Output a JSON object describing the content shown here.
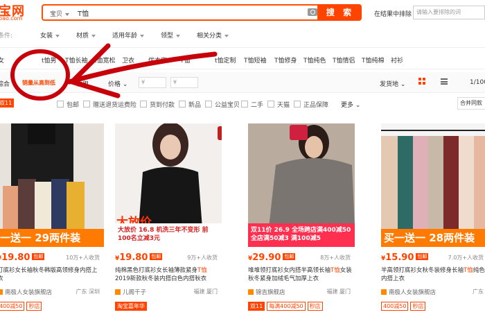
{
  "header": {
    "logo": "宝网",
    "logo_sub": "bao.com",
    "search_scope": "宝贝",
    "search_value": "T恤",
    "search_button": "搜 索",
    "within_label": "在结果中排除",
    "within_placeholder": "请输入要排除的词"
  },
  "filter1": {
    "label": "条件:",
    "items": [
      "女装",
      "材质",
      "适用年龄",
      "领型",
      "相关分类"
    ]
  },
  "filter2": {
    "items": [
      "女",
      "t恤男",
      "T恤长袖",
      "t恤宽松",
      "卫衣",
      "优衣库",
      "T恤",
      "t恤定制",
      "T恤短袖",
      "T恤修身",
      "T恤纯色",
      "T恤情侣",
      "T恤纯棉",
      "衬衫"
    ]
  },
  "sortbar": {
    "left": "综合",
    "sales": "销量从高到低",
    "credit": "信用",
    "price": "价格",
    "price_from": "¥",
    "price_to": "¥",
    "ship_from": "发货地",
    "page": "1/100"
  },
  "filter3": {
    "badge": "双11",
    "checks": [
      "包邮",
      "赠送退货运费险",
      "货到付款",
      "新品",
      "公益宝贝",
      "二手",
      "天猫",
      "正品保障"
    ],
    "more": "更多",
    "combine": "合并同款"
  },
  "products": [
    {
      "promo": "一送一 29两件装",
      "price": "19.80",
      "paid": "10万+人收货",
      "title_pre": "打底衫女长袖秋冬韩版高领修身内搭",
      "title_em": "",
      "title_post": "上衣",
      "shop": "南极人女装旗舰店",
      "loc": "广东 深圳",
      "tags": [
        "400减50",
        "秒店"
      ],
      "colors": {
        "promo_bg": "#ff7a00",
        "img_bg": "#e8e2dc"
      }
    },
    {
      "promo": "大放价 16.8 机洗三年不变形 前100名立减3元",
      "price": "19.80",
      "paid": "9万+人收货",
      "title_pre": "纯棉黑色打底衫女长袖薄款紧身",
      "title_em": "T恤",
      "title_post": "2019新款秋冬装内搭白色内搭秋衣",
      "shop": "儿阁千子",
      "loc": "福建 厦门",
      "tags": [
        "淘宝嘉年华"
      ],
      "colors": {
        "promo_bg": "#ffffff",
        "img_bg": "#f2efec"
      }
    },
    {
      "promo": "双11价 26.9 全场跨店满400减50 全店满50减3 满100减5",
      "price": "29.90",
      "paid": "8万+人收货",
      "title_pre": "堆堆领打底衫女内搭半高领长袖",
      "title_em": "T恤",
      "title_post": "女装秋冬紧身加绒毛气加厚上衣",
      "shop": "锦吉旗舰店",
      "loc": "福建 厦门",
      "tags": [
        "双11",
        "每满400减50",
        "秒店"
      ],
      "colors": {
        "promo_bg": "#ff2f4f",
        "img_bg": "#b9ab9e"
      }
    },
    {
      "promo": "买一送一 28两件装",
      "price": "15.90",
      "paid": "7.0万+人收货",
      "title_pre": "半高领打底衫女秋冬装修身长袖",
      "title_em": "T恤",
      "title_post": "纯色内搭上衣",
      "shop": "南极人女装旗舰店",
      "loc": "广东",
      "tags": [
        "400减50",
        "秒店"
      ],
      "colors": {
        "promo_bg": "#ff7a00",
        "img_bg": "#f4f4f4"
      }
    }
  ],
  "colors": {
    "accent": "#ff4400",
    "annotation": "#c8000a"
  }
}
